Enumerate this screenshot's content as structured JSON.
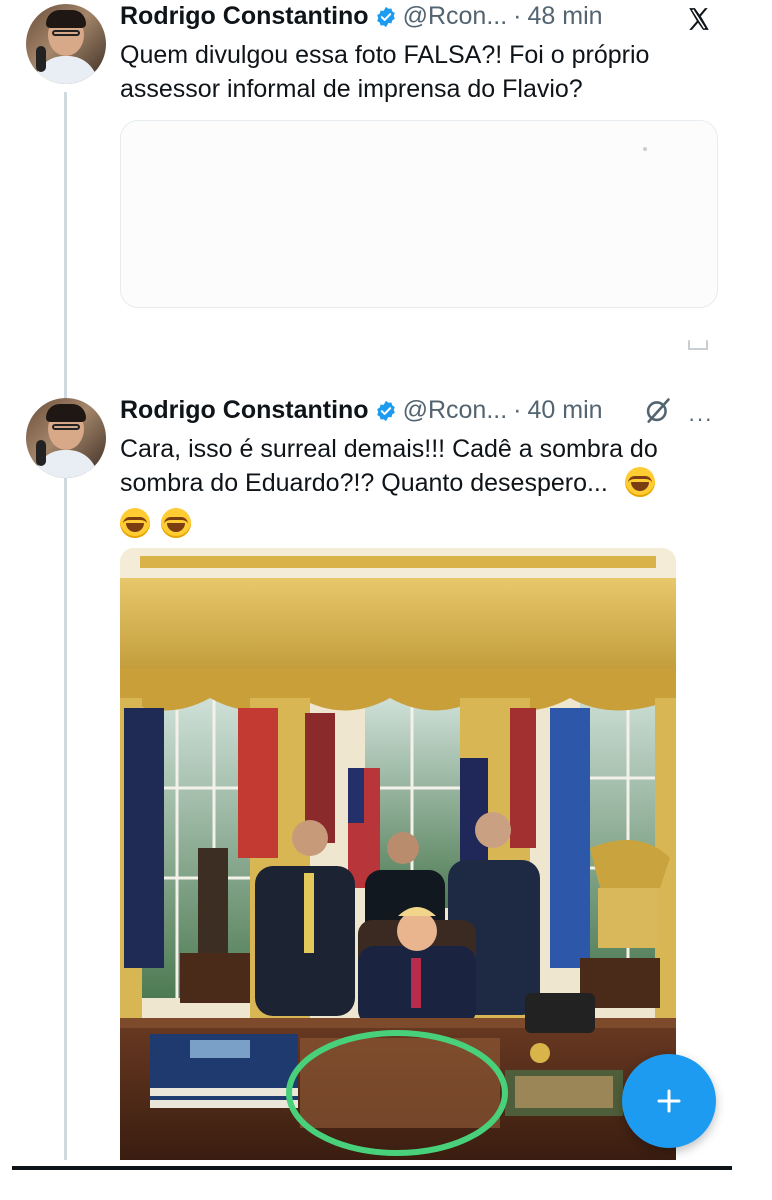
{
  "tweets": [
    {
      "author": "Rodrigo Constantino",
      "handle": "@Rcon...",
      "separator": "·",
      "time": "48 min",
      "text": "Quem divulgou essa foto FALSA?! Foi o próprio assessor informal de imprensa do Flavio?"
    },
    {
      "author": "Rodrigo Constantino",
      "handle": "@Rcon...",
      "separator": "·",
      "time": "40 min",
      "text": "Cara, isso é surreal demais!!! Cadê a sombra do sombra do Eduardo?!? Quanto desespero...",
      "more": "···"
    }
  ],
  "icons": [
    "x-logo-icon",
    "verified-icon",
    "grok-icon",
    "more-icon",
    "share-icon",
    "laughing-emoji-icon",
    "plus-icon"
  ],
  "colors": {
    "accent": "#1d9bf0",
    "highlight_circle": "#48d17a",
    "secondary_text": "#536471"
  }
}
